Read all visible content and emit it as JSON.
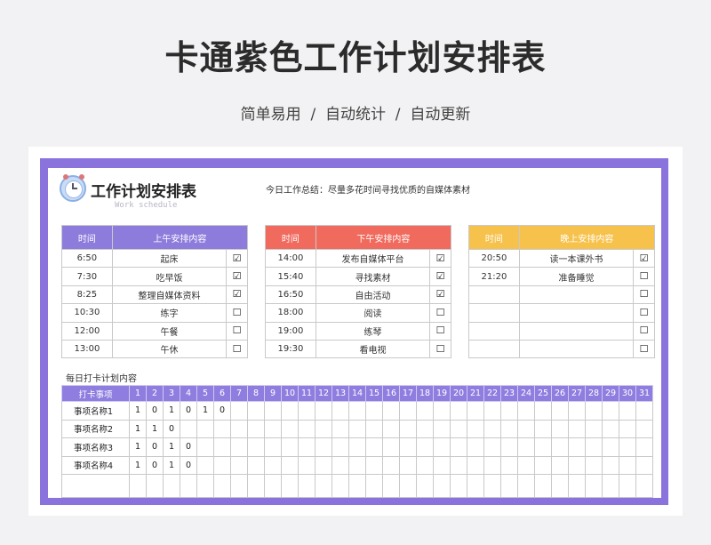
{
  "page": {
    "title": "卡通紫色工作计划安排表",
    "subtitle": "简单易用  /  自动统计  /  自动更新"
  },
  "sheet": {
    "heading": "工作计划安排表",
    "heading_en": "Work schedule",
    "summary": "今日工作总结：尽量多花时间寻找优质的自媒体素材"
  },
  "colors": {
    "frame": "#8a73dc",
    "morning_time": "#8e7cdc",
    "morning_head": "#8e7cdc",
    "afternoon_time": "#f06a5e",
    "afternoon_head": "#f06a5e",
    "evening_time": "#f6c24c",
    "evening_head": "#f6c24c"
  },
  "schedules": [
    {
      "time_header": "时间",
      "content_header": "上午安排内容",
      "rows": [
        {
          "time": "6:50",
          "task": "起床",
          "checked": "☑"
        },
        {
          "time": "7:30",
          "task": "吃早饭",
          "checked": "☑"
        },
        {
          "time": "8:25",
          "task": "整理自媒体资料",
          "checked": "☑"
        },
        {
          "time": "10:30",
          "task": "练字",
          "checked": "☐"
        },
        {
          "time": "12:00",
          "task": "午餐",
          "checked": "☐"
        },
        {
          "time": "13:00",
          "task": "午休",
          "checked": "☐"
        }
      ]
    },
    {
      "time_header": "时间",
      "content_header": "下午安排内容",
      "rows": [
        {
          "time": "14:00",
          "task": "发布自媒体平台",
          "checked": "☑"
        },
        {
          "time": "15:40",
          "task": "寻找素材",
          "checked": "☑"
        },
        {
          "time": "16:50",
          "task": "自由活动",
          "checked": "☑"
        },
        {
          "time": "18:00",
          "task": "阅读",
          "checked": "☐"
        },
        {
          "time": "19:00",
          "task": "练琴",
          "checked": "☐"
        },
        {
          "time": "19:30",
          "task": "看电视",
          "checked": "☐"
        }
      ]
    },
    {
      "time_header": "时间",
      "content_header": "晚上安排内容",
      "rows": [
        {
          "time": "20:50",
          "task": "读一本课外书",
          "checked": "☑"
        },
        {
          "time": "21:20",
          "task": "准备睡觉",
          "checked": "☐"
        },
        {
          "time": "",
          "task": "",
          "checked": "☐"
        },
        {
          "time": "",
          "task": "",
          "checked": "☐"
        },
        {
          "time": "",
          "task": "",
          "checked": "☐"
        },
        {
          "time": "",
          "task": "",
          "checked": "☐"
        }
      ]
    }
  ],
  "tracker": {
    "title": "每日打卡计划内容",
    "header_label": "打卡事项",
    "days": [
      "1",
      "2",
      "3",
      "4",
      "5",
      "6",
      "7",
      "8",
      "9",
      "10",
      "11",
      "12",
      "13",
      "14",
      "15",
      "16",
      "17",
      "18",
      "19",
      "20",
      "21",
      "22",
      "23",
      "24",
      "25",
      "26",
      "27",
      "28",
      "29",
      "30",
      "31"
    ],
    "rows": [
      {
        "name": "事项名称1",
        "values": [
          "1",
          "0",
          "1",
          "0",
          "1",
          "0"
        ]
      },
      {
        "name": "事项名称2",
        "values": [
          "1",
          "1",
          "0"
        ]
      },
      {
        "name": "事项名称3",
        "values": [
          "1",
          "0",
          "1",
          "0"
        ]
      },
      {
        "name": "事项名称4",
        "values": [
          "1",
          "0",
          "1",
          "0"
        ]
      },
      {
        "name": "",
        "values": []
      }
    ]
  }
}
